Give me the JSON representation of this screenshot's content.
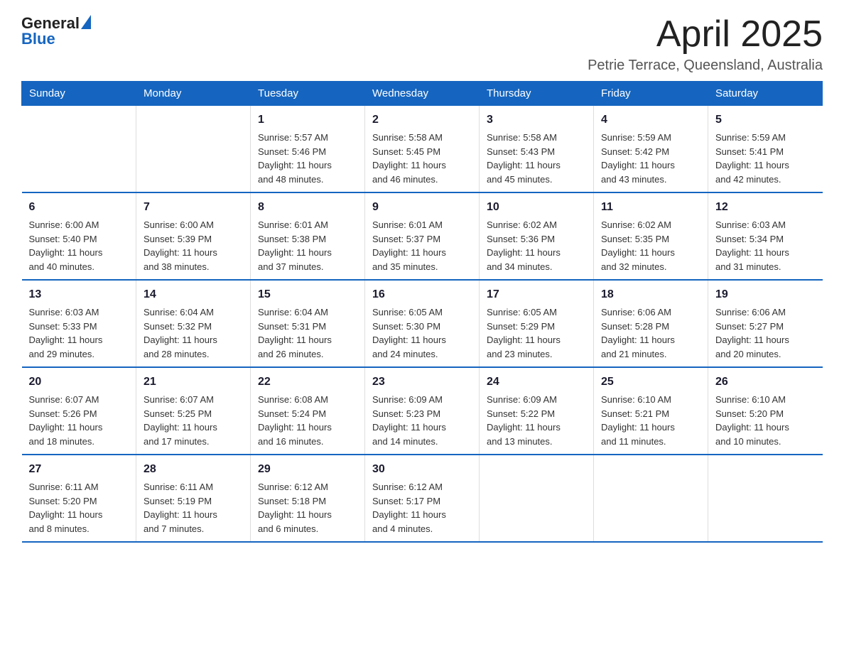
{
  "header": {
    "logo_general": "General",
    "logo_blue": "Blue",
    "month_title": "April 2025",
    "location": "Petrie Terrace, Queensland, Australia"
  },
  "days_of_week": [
    "Sunday",
    "Monday",
    "Tuesday",
    "Wednesday",
    "Thursday",
    "Friday",
    "Saturday"
  ],
  "weeks": [
    [
      {
        "day": "",
        "info": ""
      },
      {
        "day": "",
        "info": ""
      },
      {
        "day": "1",
        "info": "Sunrise: 5:57 AM\nSunset: 5:46 PM\nDaylight: 11 hours\nand 48 minutes."
      },
      {
        "day": "2",
        "info": "Sunrise: 5:58 AM\nSunset: 5:45 PM\nDaylight: 11 hours\nand 46 minutes."
      },
      {
        "day": "3",
        "info": "Sunrise: 5:58 AM\nSunset: 5:43 PM\nDaylight: 11 hours\nand 45 minutes."
      },
      {
        "day": "4",
        "info": "Sunrise: 5:59 AM\nSunset: 5:42 PM\nDaylight: 11 hours\nand 43 minutes."
      },
      {
        "day": "5",
        "info": "Sunrise: 5:59 AM\nSunset: 5:41 PM\nDaylight: 11 hours\nand 42 minutes."
      }
    ],
    [
      {
        "day": "6",
        "info": "Sunrise: 6:00 AM\nSunset: 5:40 PM\nDaylight: 11 hours\nand 40 minutes."
      },
      {
        "day": "7",
        "info": "Sunrise: 6:00 AM\nSunset: 5:39 PM\nDaylight: 11 hours\nand 38 minutes."
      },
      {
        "day": "8",
        "info": "Sunrise: 6:01 AM\nSunset: 5:38 PM\nDaylight: 11 hours\nand 37 minutes."
      },
      {
        "day": "9",
        "info": "Sunrise: 6:01 AM\nSunset: 5:37 PM\nDaylight: 11 hours\nand 35 minutes."
      },
      {
        "day": "10",
        "info": "Sunrise: 6:02 AM\nSunset: 5:36 PM\nDaylight: 11 hours\nand 34 minutes."
      },
      {
        "day": "11",
        "info": "Sunrise: 6:02 AM\nSunset: 5:35 PM\nDaylight: 11 hours\nand 32 minutes."
      },
      {
        "day": "12",
        "info": "Sunrise: 6:03 AM\nSunset: 5:34 PM\nDaylight: 11 hours\nand 31 minutes."
      }
    ],
    [
      {
        "day": "13",
        "info": "Sunrise: 6:03 AM\nSunset: 5:33 PM\nDaylight: 11 hours\nand 29 minutes."
      },
      {
        "day": "14",
        "info": "Sunrise: 6:04 AM\nSunset: 5:32 PM\nDaylight: 11 hours\nand 28 minutes."
      },
      {
        "day": "15",
        "info": "Sunrise: 6:04 AM\nSunset: 5:31 PM\nDaylight: 11 hours\nand 26 minutes."
      },
      {
        "day": "16",
        "info": "Sunrise: 6:05 AM\nSunset: 5:30 PM\nDaylight: 11 hours\nand 24 minutes."
      },
      {
        "day": "17",
        "info": "Sunrise: 6:05 AM\nSunset: 5:29 PM\nDaylight: 11 hours\nand 23 minutes."
      },
      {
        "day": "18",
        "info": "Sunrise: 6:06 AM\nSunset: 5:28 PM\nDaylight: 11 hours\nand 21 minutes."
      },
      {
        "day": "19",
        "info": "Sunrise: 6:06 AM\nSunset: 5:27 PM\nDaylight: 11 hours\nand 20 minutes."
      }
    ],
    [
      {
        "day": "20",
        "info": "Sunrise: 6:07 AM\nSunset: 5:26 PM\nDaylight: 11 hours\nand 18 minutes."
      },
      {
        "day": "21",
        "info": "Sunrise: 6:07 AM\nSunset: 5:25 PM\nDaylight: 11 hours\nand 17 minutes."
      },
      {
        "day": "22",
        "info": "Sunrise: 6:08 AM\nSunset: 5:24 PM\nDaylight: 11 hours\nand 16 minutes."
      },
      {
        "day": "23",
        "info": "Sunrise: 6:09 AM\nSunset: 5:23 PM\nDaylight: 11 hours\nand 14 minutes."
      },
      {
        "day": "24",
        "info": "Sunrise: 6:09 AM\nSunset: 5:22 PM\nDaylight: 11 hours\nand 13 minutes."
      },
      {
        "day": "25",
        "info": "Sunrise: 6:10 AM\nSunset: 5:21 PM\nDaylight: 11 hours\nand 11 minutes."
      },
      {
        "day": "26",
        "info": "Sunrise: 6:10 AM\nSunset: 5:20 PM\nDaylight: 11 hours\nand 10 minutes."
      }
    ],
    [
      {
        "day": "27",
        "info": "Sunrise: 6:11 AM\nSunset: 5:20 PM\nDaylight: 11 hours\nand 8 minutes."
      },
      {
        "day": "28",
        "info": "Sunrise: 6:11 AM\nSunset: 5:19 PM\nDaylight: 11 hours\nand 7 minutes."
      },
      {
        "day": "29",
        "info": "Sunrise: 6:12 AM\nSunset: 5:18 PM\nDaylight: 11 hours\nand 6 minutes."
      },
      {
        "day": "30",
        "info": "Sunrise: 6:12 AM\nSunset: 5:17 PM\nDaylight: 11 hours\nand 4 minutes."
      },
      {
        "day": "",
        "info": ""
      },
      {
        "day": "",
        "info": ""
      },
      {
        "day": "",
        "info": ""
      }
    ]
  ]
}
